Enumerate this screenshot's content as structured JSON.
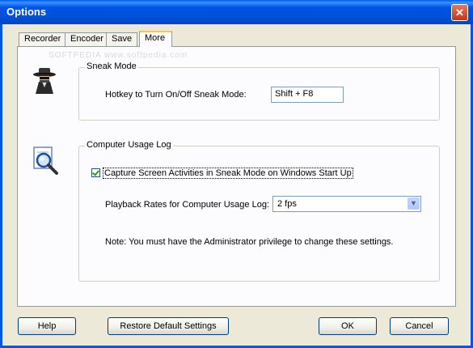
{
  "window": {
    "title": "Options"
  },
  "tabs": [
    {
      "label": "Recorder"
    },
    {
      "label": "Encoder"
    },
    {
      "label": "Save"
    },
    {
      "label": "More"
    }
  ],
  "watermark": "SOFTPEDIA www.softpedia.com",
  "sneak_mode": {
    "group_label": "Sneak Mode",
    "hotkey_label": "Hotkey to Turn On/Off Sneak Mode:",
    "hotkey_value": "Shift + F8"
  },
  "usage_log": {
    "group_label": "Computer Usage Log",
    "capture_checkbox_label": "Capture Screen Activities in Sneak Mode on Windows Start Up",
    "capture_checked": true,
    "playback_label": "Playback Rates for Computer Usage Log:",
    "playback_value": "2 fps",
    "note": "Note: You must have the Administrator privilege to change these settings."
  },
  "buttons": {
    "help": "Help",
    "restore": "Restore Default Settings",
    "ok": "OK",
    "cancel": "Cancel"
  },
  "icons": {
    "sneak": "spy-icon",
    "log": "magnifier-document-icon",
    "close": "close-icon"
  }
}
